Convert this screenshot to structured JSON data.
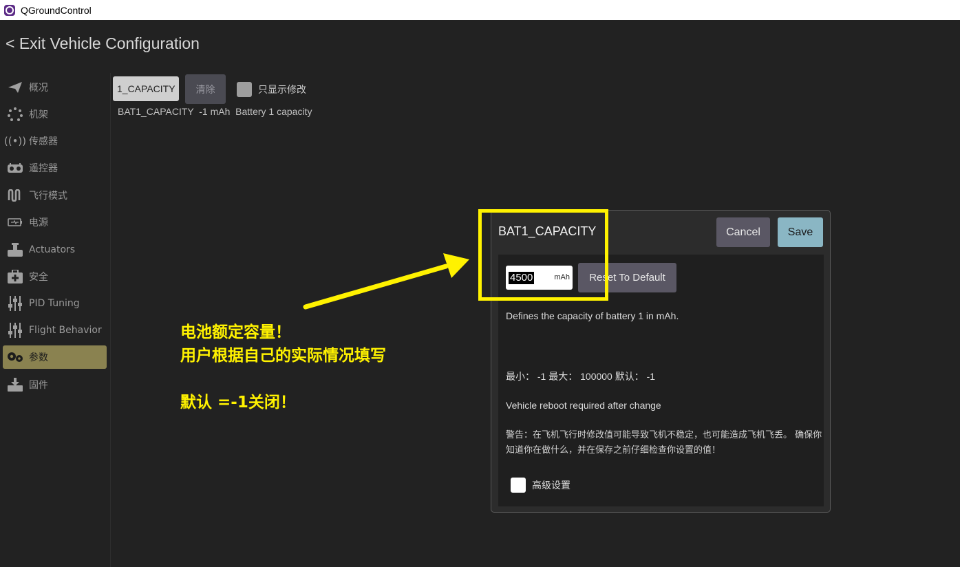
{
  "window": {
    "title": "QGroundControl"
  },
  "header": {
    "exit_label": "< Exit Vehicle Configuration"
  },
  "sidebar": {
    "items": [
      {
        "label": "概况",
        "icon": "paper-plane-icon"
      },
      {
        "label": "机架",
        "icon": "airframe-dots-icon"
      },
      {
        "label": "传感器",
        "icon": "sensor-wave-icon"
      },
      {
        "label": "遥控器",
        "icon": "radio-controller-icon"
      },
      {
        "label": "飞行模式",
        "icon": "flight-mode-wave-icon"
      },
      {
        "label": "电源",
        "icon": "battery-icon"
      },
      {
        "label": "Actuators",
        "icon": "actuator-icon"
      },
      {
        "label": "安全",
        "icon": "first-aid-icon"
      },
      {
        "label": "PID Tuning",
        "icon": "sliders-icon"
      },
      {
        "label": "Flight Behavior",
        "icon": "sliders-icon"
      },
      {
        "label": "参数",
        "icon": "gears-icon",
        "active": true
      },
      {
        "label": "固件",
        "icon": "firmware-download-icon"
      }
    ]
  },
  "params": {
    "search_value": "1_CAPACITY",
    "clear_label": "清除",
    "only_modified_label": "只显示修改",
    "row": {
      "name": "BAT1_CAPACITY",
      "value": "-1 mAh",
      "description": "Battery 1 capacity"
    }
  },
  "dialog": {
    "title": "BAT1_CAPACITY",
    "cancel_label": "Cancel",
    "save_label": "Save",
    "value": "4500",
    "unit": "mAh",
    "reset_label": "Reset To Default",
    "description": "Defines the capacity of battery 1 in mAh.",
    "range_text": "最小： -1  最大： 100000  默认： -1",
    "reboot_text": "Vehicle reboot required after change",
    "warning_text": "警告：在飞机飞行时修改值可能导致飞机不稳定，也可能造成飞机飞丢。 确保你知道你在做什么，并在保存之前仔细检查你设置的值！",
    "advanced_label": "高级设置"
  },
  "annotation": {
    "line1": "电池额定容量！",
    "line2": "用户根据自己的实际情况填写",
    "line3": "默认 =-1关闭！",
    "color": "#fff200"
  }
}
